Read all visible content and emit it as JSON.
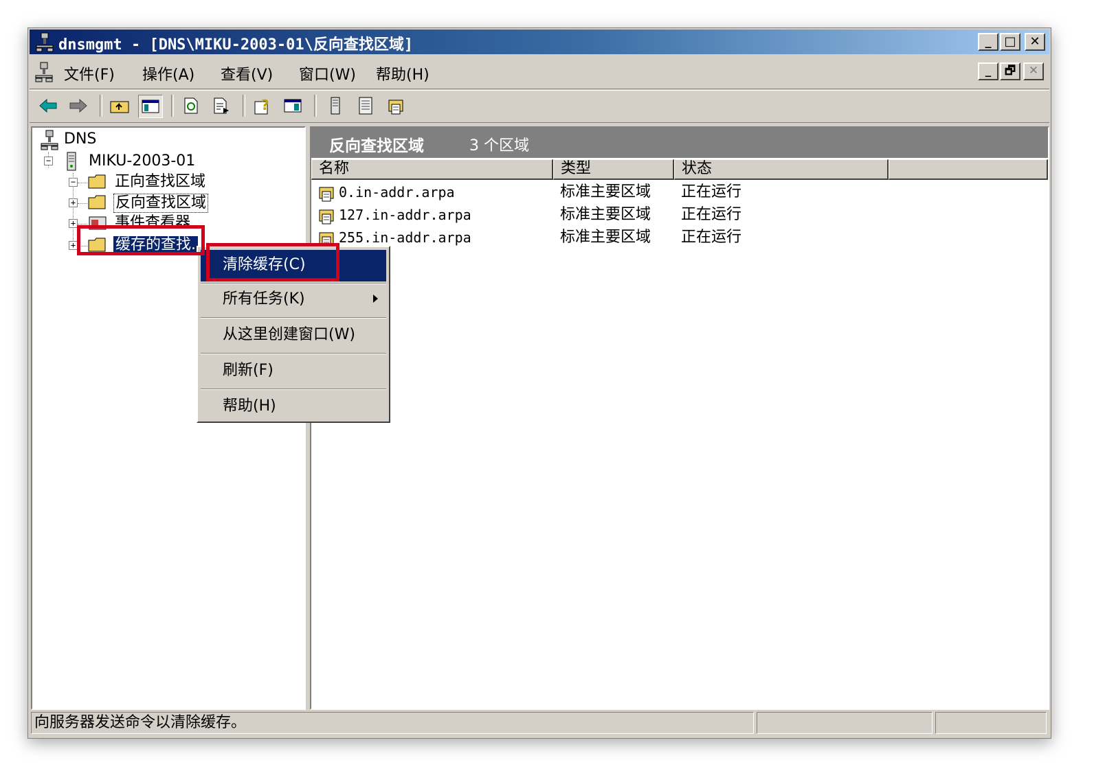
{
  "window": {
    "title": "dnsmgmt - [DNS\\MIKU-2003-01\\反向查找区域]",
    "minimize": "_",
    "maximize": "□",
    "close": "✕"
  },
  "menubar": {
    "items": [
      "文件(F)",
      "操作(A)",
      "查看(V)",
      "窗口(W)",
      "帮助(H)"
    ],
    "restore": "🗗"
  },
  "tree": {
    "root": "DNS",
    "server": "MIKU-2003-01",
    "nodes": [
      "正向查找区域",
      "反向查找区域",
      "事件查看器",
      "缓存的查找."
    ]
  },
  "right_pane": {
    "header_title": "反向查找区域",
    "header_count": "3 个区域",
    "columns": [
      "名称",
      "类型",
      "状态"
    ],
    "rows": [
      {
        "name": "0.in-addr.arpa",
        "type": "标准主要区域",
        "status": "正在运行"
      },
      {
        "name": "127.in-addr.arpa",
        "type": "标准主要区域",
        "status": "正在运行"
      },
      {
        "name": "255.in-addr.arpa",
        "type": "标准主要区域",
        "status": "正在运行"
      }
    ]
  },
  "context_menu": {
    "items": [
      "清除缓存(C)",
      "所有任务(K)",
      "从这里创建窗口(W)",
      "刷新(F)",
      "帮助(H)"
    ]
  },
  "statusbar": {
    "text": "向服务器发送命令以清除缓存。"
  },
  "colors": {
    "title_start": "#0a246a",
    "title_end": "#a6caf0",
    "face": "#d4d0c8",
    "selection": "#0a246a",
    "highlight_box": "#d0021b"
  }
}
